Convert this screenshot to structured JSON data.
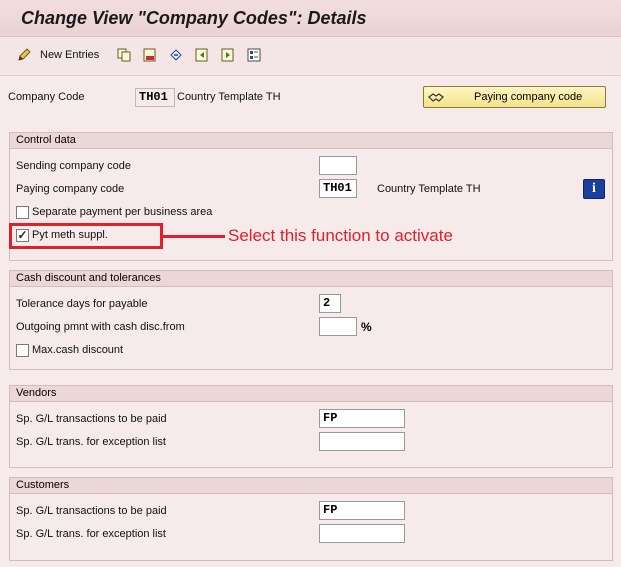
{
  "window": {
    "title": "Change View \"Company Codes\": Details"
  },
  "toolbar": {
    "new_entries_label": "New Entries",
    "icons": [
      "new-entries-pencil-icon",
      "copy-icon",
      "delete-icon",
      "undo-icon",
      "previous-entry-icon",
      "next-entry-icon",
      "select-all-icon"
    ]
  },
  "header": {
    "company_code_label": "Company Code",
    "company_code_value": "TH01",
    "company_name": "Country Template TH",
    "paying_company_button_label": "Paying company code"
  },
  "control_data": {
    "title": "Control data",
    "sending_company_label": "Sending company code",
    "sending_company_value": "",
    "paying_company_label": "Paying company code",
    "paying_company_value": "TH01",
    "paying_company_name": "Country Template TH",
    "separate_payment_label": "Separate payment per business area",
    "separate_payment_checked": false,
    "pyt_meth_label": "Pyt meth suppl.",
    "pyt_meth_checked": true
  },
  "annotation": {
    "text": "Select this function to activate",
    "color": "#e0202a"
  },
  "cash_discount": {
    "title": "Cash discount and tolerances",
    "tolerance_days_label": "Tolerance days for payable",
    "tolerance_days_value": "2",
    "outgoing_pmnt_label": "Outgoing pmnt with cash disc.from",
    "outgoing_pmnt_value": "",
    "outgoing_pmnt_unit": "%",
    "max_cash_discount_label": "Max.cash discount",
    "max_cash_discount_checked": false
  },
  "vendors": {
    "title": "Vendors",
    "sp_gl_paid_label": "Sp. G/L transactions to be paid",
    "sp_gl_paid_value": "FP",
    "sp_gl_exception_label": "Sp. G/L trans. for exception list",
    "sp_gl_exception_value": ""
  },
  "customers": {
    "title": "Customers",
    "sp_gl_paid_label": "Sp. G/L transactions to be paid",
    "sp_gl_paid_value": "FP",
    "sp_gl_exception_label": "Sp. G/L trans. for exception list",
    "sp_gl_exception_value": ""
  },
  "colors": {
    "background": "#f7eaea",
    "accent_red": "#e0202a",
    "info_blue": "#1a3f9c",
    "button_yellow": "#f3e38a"
  }
}
